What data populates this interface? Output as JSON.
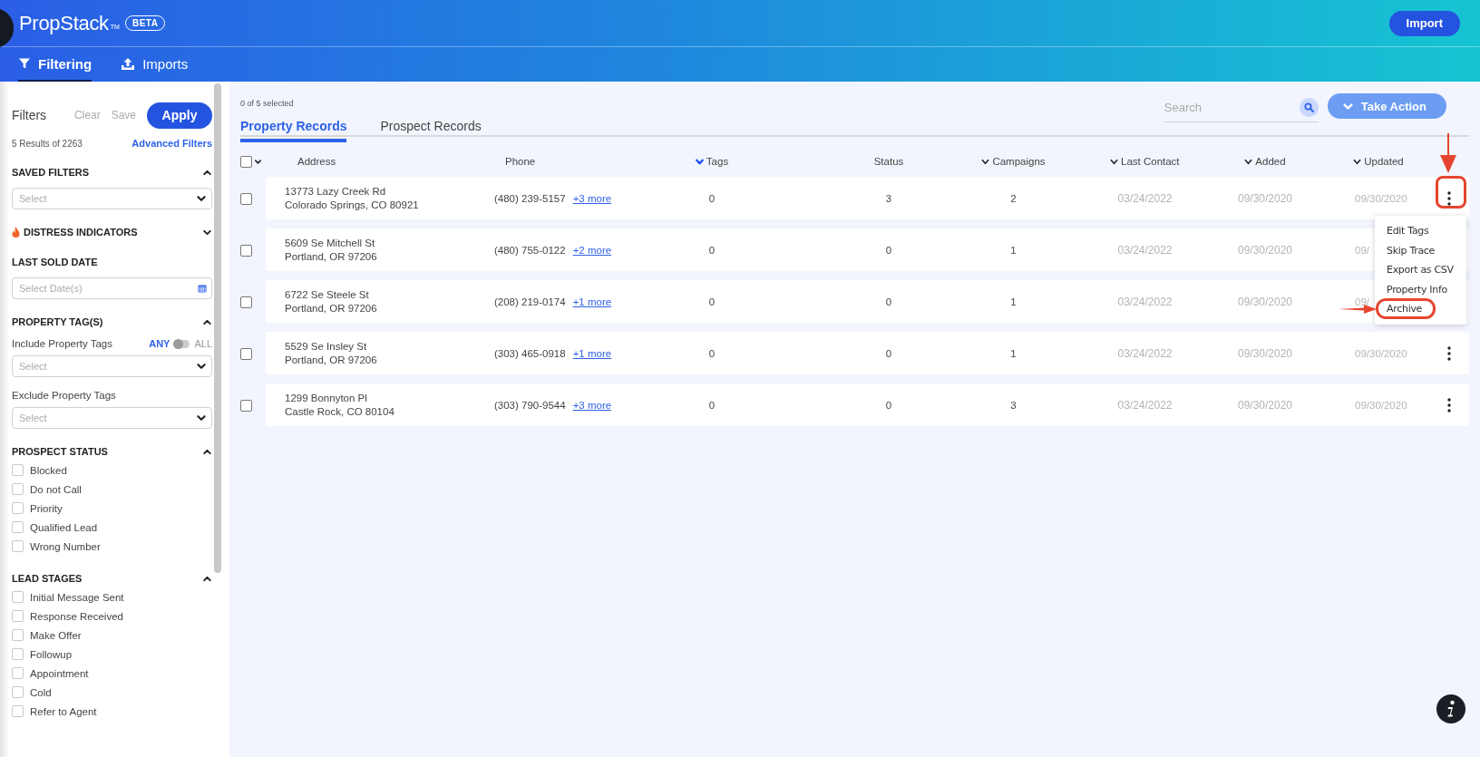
{
  "app": {
    "name": "PropStack",
    "trademark": "TM",
    "badge": "BETA",
    "import_button": "Import"
  },
  "nav_tabs": [
    {
      "label": "Filtering",
      "selected": true
    },
    {
      "label": "Imports",
      "selected": false
    }
  ],
  "filters": {
    "title": "Filters",
    "clear": "Clear",
    "save": "Save",
    "apply": "Apply",
    "results": "5 Results of 2263",
    "advanced": "Advanced Filters",
    "sections": [
      {
        "title": "SAVED FILTERS",
        "kind": "collapsible",
        "expanded": true,
        "controls": [
          {
            "kind": "select",
            "placeholder": "Select"
          }
        ]
      },
      {
        "title": "DISTRESS INDICATORS",
        "kind": "flagged",
        "expanded": false
      },
      {
        "title": "LAST SOLD DATE",
        "kind": "fixed",
        "controls": [
          {
            "kind": "date",
            "placeholder": "Select Date(s)"
          }
        ]
      },
      {
        "title": "PROPERTY TAG(S)",
        "kind": "collapsible",
        "expanded": true,
        "controls": [
          {
            "kind": "label",
            "text": "Include Property Tags",
            "toggle": {
              "left": "ANY",
              "right": "ALL",
              "on": false
            }
          },
          {
            "kind": "select",
            "placeholder": "Select"
          },
          {
            "kind": "label",
            "text": "Exclude Property Tags"
          },
          {
            "kind": "select",
            "placeholder": "Select"
          }
        ]
      },
      {
        "title": "PROSPECT STATUS",
        "kind": "collapsible",
        "expanded": true,
        "controls": [
          {
            "kind": "checkbox",
            "label": "Blocked",
            "checked": false
          },
          {
            "kind": "checkbox",
            "label": "Do not Call",
            "checked": false
          },
          {
            "kind": "checkbox",
            "label": "Priority",
            "checked": false
          },
          {
            "kind": "checkbox",
            "label": "Qualified Lead",
            "checked": false
          },
          {
            "kind": "checkbox",
            "label": "Wrong Number",
            "checked": false
          }
        ]
      },
      {
        "title": "LEAD STAGES",
        "kind": "collapsible",
        "expanded": true,
        "controls": [
          {
            "kind": "checkbox",
            "label": "Initial Message Sent",
            "checked": false
          },
          {
            "kind": "checkbox",
            "label": "Response Received",
            "checked": false
          },
          {
            "kind": "checkbox",
            "label": "Make Offer",
            "checked": false
          },
          {
            "kind": "checkbox",
            "label": "Followup",
            "checked": false
          },
          {
            "kind": "checkbox",
            "label": "Appointment",
            "checked": false
          },
          {
            "kind": "checkbox",
            "label": "Cold",
            "checked": false
          },
          {
            "kind": "checkbox",
            "label": "Refer to Agent",
            "checked": false
          }
        ]
      }
    ]
  },
  "records": {
    "selected_count": "0 of 5 selected",
    "tabs": [
      {
        "label": "Property Records",
        "selected": true
      },
      {
        "label": "Prospect Records",
        "selected": false
      }
    ],
    "search": {
      "placeholder": "Search"
    },
    "take_action": "Take Action",
    "select_all_checked": false,
    "columns": [
      {
        "label": "Address",
        "sortable": false
      },
      {
        "label": "Phone",
        "sortable": false
      },
      {
        "label": "Tags",
        "sortable": true,
        "active": true
      },
      {
        "label": "Status",
        "sortable": false
      },
      {
        "label": "Campaigns",
        "sortable": true,
        "active": false
      },
      {
        "label": "Last Contact",
        "sortable": true,
        "active": false
      },
      {
        "label": "Added",
        "sortable": true,
        "active": false
      },
      {
        "label": "Updated",
        "sortable": true,
        "active": false
      }
    ],
    "rows": [
      {
        "checked": false,
        "address_line1": "13773 Lazy Creek Rd",
        "address_line2": "Colorado Springs, CO 80921",
        "phone": "(480) 239-5157",
        "more": "+3 more",
        "tags": "0",
        "status": "3",
        "campaigns": "2",
        "last_contact": "03/24/2022",
        "added": "09/30/2020",
        "updated": "09/30/2020",
        "highlighted": true
      },
      {
        "checked": false,
        "address_line1": "5609 Se Mitchell St",
        "address_line2": "Portland, OR 97206",
        "phone": "(480) 755-0122",
        "more": "+2 more",
        "tags": "0",
        "status": "0",
        "campaigns": "1",
        "last_contact": "03/24/2022",
        "added": "09/30/2020",
        "updated": "09/",
        "highlighted": false
      },
      {
        "checked": false,
        "address_line1": "6722 Se Steele St",
        "address_line2": "Portland, OR 97206",
        "phone": "(208) 219-0174",
        "more": "+1 more",
        "tags": "0",
        "status": "0",
        "campaigns": "1",
        "last_contact": "03/24/2022",
        "added": "09/30/2020",
        "updated": "09/",
        "highlighted": false
      },
      {
        "checked": false,
        "address_line1": "5529 Se Insley St",
        "address_line2": "Portland, OR 97206",
        "phone": "(303) 465-0918",
        "more": "+1 more",
        "tags": "0",
        "status": "0",
        "campaigns": "1",
        "last_contact": "03/24/2022",
        "added": "09/30/2020",
        "updated": "09/30/2020",
        "highlighted": false
      },
      {
        "checked": false,
        "address_line1": "1299 Bonnyton Pl",
        "address_line2": "Castle Rock, CO 80104",
        "phone": "(303) 790-9544",
        "more": "+3 more",
        "tags": "0",
        "status": "0",
        "campaigns": "3",
        "last_contact": "03/24/2022",
        "added": "09/30/2020",
        "updated": "09/30/2020",
        "highlighted": false
      }
    ],
    "row_menu": [
      {
        "label": "Edit Tags",
        "highlighted": false
      },
      {
        "label": "Skip Trace",
        "highlighted": false
      },
      {
        "label": "Export as CSV",
        "highlighted": false
      },
      {
        "label": "Property Info",
        "highlighted": false
      },
      {
        "label": "Archive",
        "highlighted": true
      }
    ]
  }
}
